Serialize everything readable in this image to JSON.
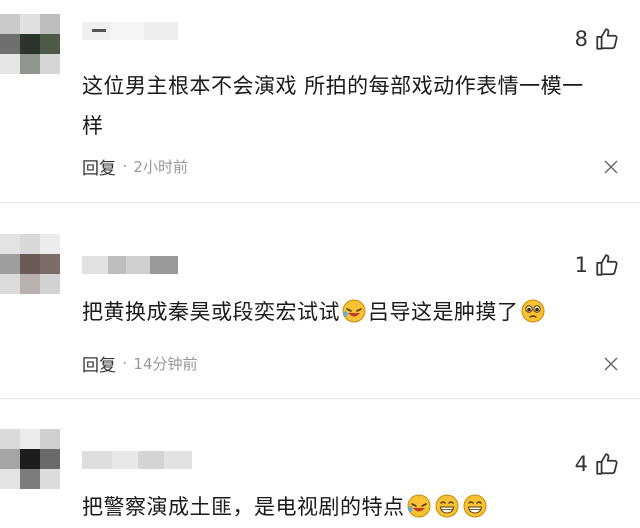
{
  "comments": [
    {
      "likes": "8",
      "text_line1": "这位男主根本不会演戏 所拍的每部戏动作表情一模一",
      "text_line2": "样",
      "reply_label": "回复",
      "separator": "·",
      "time": "2小时前"
    },
    {
      "likes": "1",
      "text_part1": "把黄换成秦昊或段奕宏试试",
      "text_part2": "吕导这是肿摸了",
      "reply_label": "回复",
      "separator": "·",
      "time": "14分钟前"
    },
    {
      "likes": "4",
      "text_part1": "把警察演成土匪，是电视剧的特点"
    }
  ],
  "icons": {
    "like": "thumbs-up-icon",
    "more": "close-icon",
    "emoji_laugh": "laughing-emoji-icon",
    "emoji_plead": "pleading-emoji-icon",
    "emoji_grin": "grinning-emoji-icon"
  },
  "colors": {
    "text": "#1a1a1a",
    "meta": "#999999",
    "emoji_yellow": "#f7c234"
  }
}
